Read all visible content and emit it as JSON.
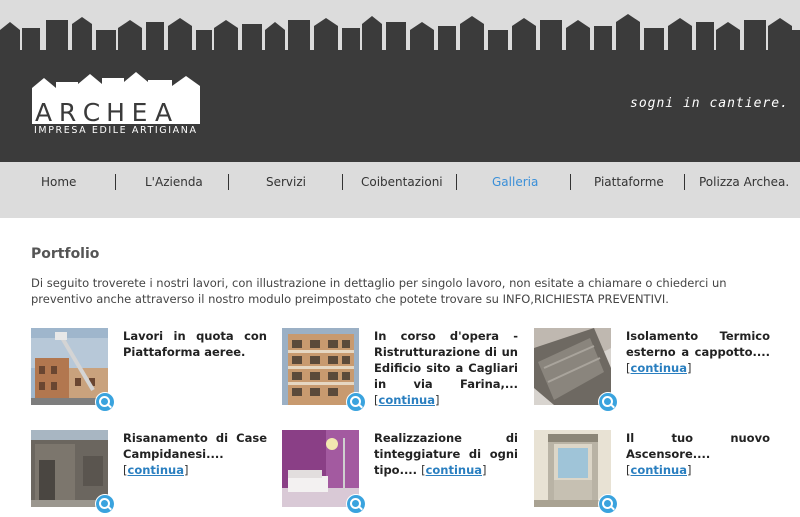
{
  "header": {
    "logo_letters": [
      "A",
      "R",
      "C",
      "H",
      "E",
      "A"
    ],
    "logo_subtitle": "IMPRESA EDILE ARTIGIANA",
    "tagline": "sogni in cantiere.",
    "bg_color": "#3b3b3b",
    "sky_color": "#dcdcdc"
  },
  "nav": {
    "items": [
      {
        "label": "Home"
      },
      {
        "label": "L'Azienda"
      },
      {
        "label": "Servizi"
      },
      {
        "label": "Coibentazioni"
      },
      {
        "label": "Galleria",
        "active": true
      },
      {
        "label": "Piattaforme"
      },
      {
        "label": "Polizza Archea."
      }
    ],
    "active_color": "#3a8fd8"
  },
  "main": {
    "title": "Portfolio",
    "intro": "Di seguito troverete i nostri lavori, con illustrazione in dettaglio per singolo lavoro, non esitate a chiamare o chiederci un preventivo anche attraverso il nostro modulo preimpostato che potete trovare su INFO,RICHIESTA PREVENTIVI.",
    "continue_label": "continua",
    "items": [
      {
        "title": "Lavori in quota con Piattaforma aeree.",
        "has_continue": false
      },
      {
        "title": "In corso d'opera - Ristrutturazione di un Edificio sito a Cagliari in via Farina,...",
        "has_continue": true
      },
      {
        "title": "Isolamento Termico esterno a cappotto....",
        "has_continue": true
      },
      {
        "title": "Risanamento di Case Campidanesi....",
        "has_continue": true
      },
      {
        "title": "Realizzazione di tinteggiature di ogni tipo....",
        "has_continue": true
      },
      {
        "title": "Il tuo nuovo Ascensore....",
        "has_continue": true
      }
    ]
  },
  "icons": {
    "zoom": "zoom-in-icon"
  }
}
